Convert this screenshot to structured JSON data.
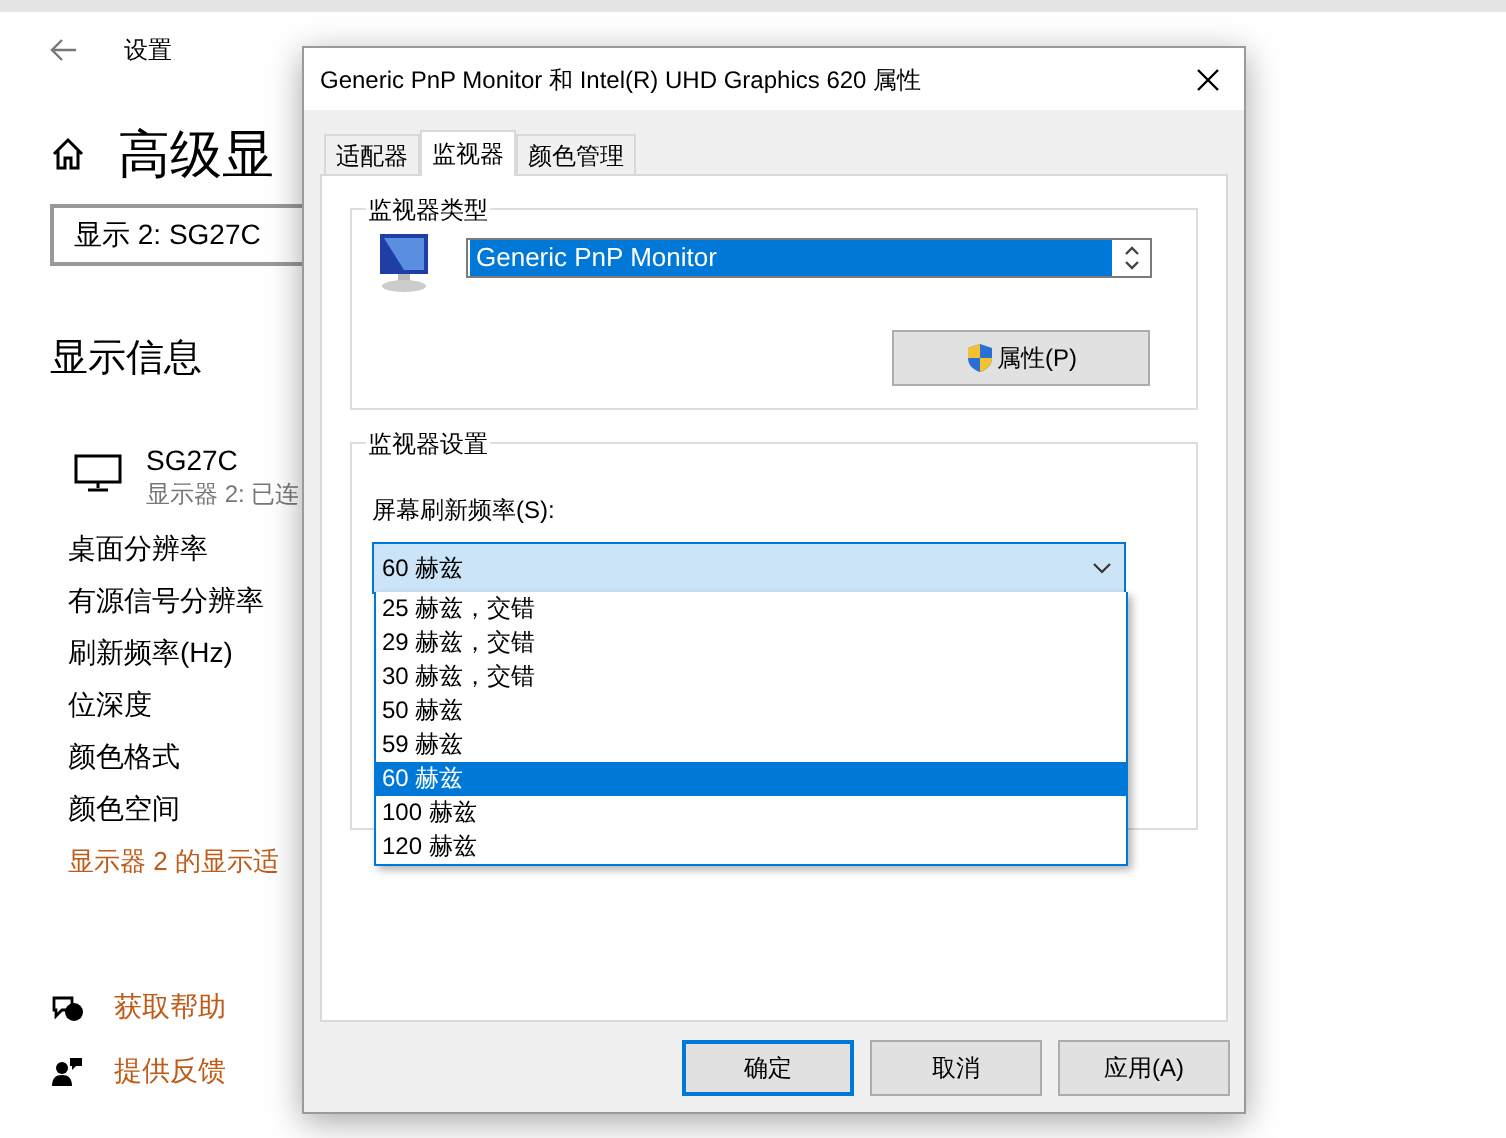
{
  "settings_window": {
    "title": "设置",
    "heading": "高级显",
    "display_select": {
      "value": "显示 2: SG27C"
    },
    "section_title": "显示信息",
    "monitor": {
      "name": "SG27C",
      "status": "显示器 2: 已连"
    },
    "info_rows": [
      "桌面分辨率",
      "有源信号分辨率",
      "刷新频率(Hz)",
      "位深度",
      "颜色格式",
      "颜色空间"
    ],
    "adapter_link": "显示器 2 的显示适",
    "help_links": [
      {
        "kind": "help",
        "label": "获取帮助"
      },
      {
        "kind": "feedback",
        "label": "提供反馈"
      }
    ]
  },
  "dialog": {
    "title": "Generic PnP Monitor 和 Intel(R) UHD Graphics 620 属性",
    "tabs": [
      {
        "label": "适配器",
        "selected": false
      },
      {
        "label": "监视器",
        "selected": true
      },
      {
        "label": "颜色管理",
        "selected": false
      }
    ],
    "monitor_type": {
      "group_label": "监视器类型",
      "monitor_list": {
        "value": "Generic PnP Monitor"
      },
      "properties_button": "属性(P)"
    },
    "monitor_settings": {
      "group_label": "监视器设置",
      "refresh_label": "屏幕刷新频率(S):",
      "refresh_select": {
        "value": "60 赫兹",
        "expanded": true,
        "options": [
          {
            "label": "25 赫兹，交错",
            "selected": false
          },
          {
            "label": "29 赫兹，交错",
            "selected": false
          },
          {
            "label": "30 赫兹，交错",
            "selected": false
          },
          {
            "label": "50 赫兹",
            "selected": false
          },
          {
            "label": "59 赫兹",
            "selected": false
          },
          {
            "label": "60 赫兹",
            "selected": true
          },
          {
            "label": "100 赫兹",
            "selected": false
          },
          {
            "label": "120 赫兹",
            "selected": false
          }
        ]
      }
    },
    "buttons": [
      {
        "label": "确定",
        "focused": true
      },
      {
        "label": "取消",
        "focused": false
      },
      {
        "label": "应用(A)",
        "focused": false
      }
    ]
  }
}
